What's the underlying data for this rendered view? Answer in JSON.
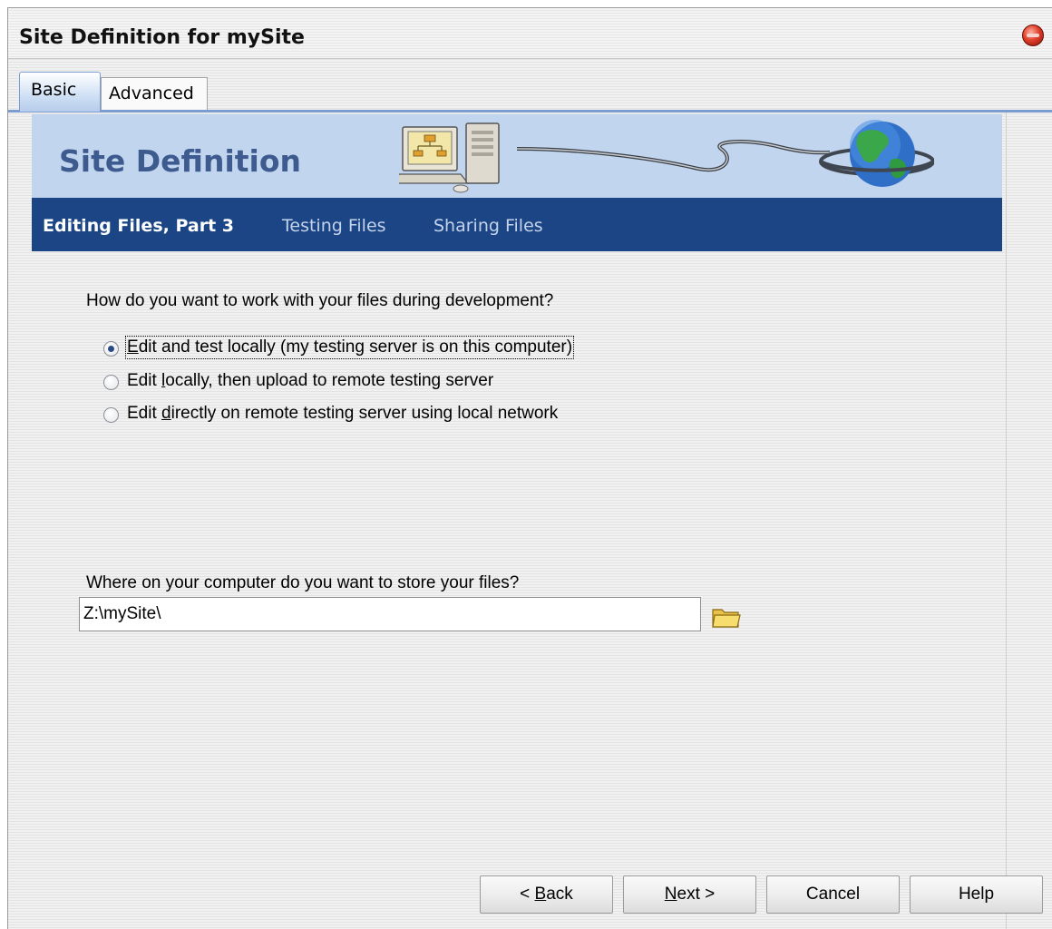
{
  "window": {
    "title": "Site Definition for mySite"
  },
  "tabs": [
    {
      "label": "Basic",
      "active": true
    },
    {
      "label": "Advanced",
      "active": false
    }
  ],
  "banner": {
    "title": "Site Definition",
    "icons": [
      "computer-icon",
      "globe-icon"
    ]
  },
  "steps": [
    {
      "label": "Editing Files, Part 3",
      "current": true
    },
    {
      "label": "Testing Files",
      "current": false
    },
    {
      "label": "Sharing Files",
      "current": false
    }
  ],
  "question": "How do you want to work with your files during development?",
  "options": [
    {
      "before": "",
      "mnemonic": "E",
      "after": "dit and test locally (my testing server is on this computer)",
      "checked": true
    },
    {
      "before": "Edit ",
      "mnemonic": "l",
      "after": "ocally, then upload to remote testing server",
      "checked": false
    },
    {
      "before": "Edit ",
      "mnemonic": "d",
      "after": "irectly on remote testing server using local network",
      "checked": false
    }
  ],
  "storage": {
    "label": "Where on your computer do you want to store your files?",
    "path": "Z:\\mySite\\"
  },
  "buttons": {
    "back": {
      "before": "< ",
      "mnemonic": "B",
      "after": "ack"
    },
    "next": {
      "before": "",
      "mnemonic": "N",
      "after": "ext >"
    },
    "cancel": "Cancel",
    "help": "Help"
  },
  "colors": {
    "banner_bg": "#c2d5ee",
    "stepbar_bg": "#1b4585",
    "banner_title": "#3d5b8e"
  }
}
